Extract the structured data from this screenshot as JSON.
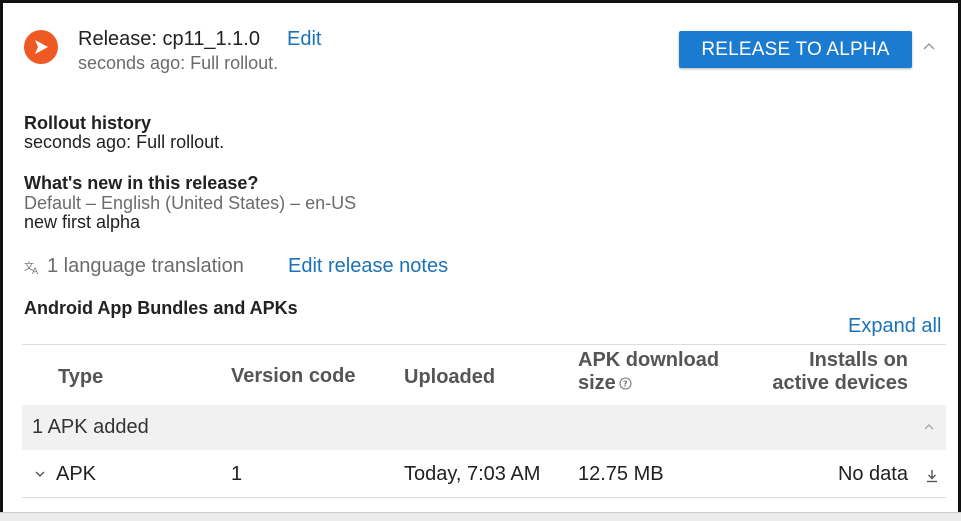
{
  "release": {
    "title": "Release: cp11_1.1.0",
    "edit_label": "Edit",
    "subtitle": "seconds ago: Full rollout.",
    "primary_button": "RELEASE TO ALPHA",
    "logo_color": "#ef5a24",
    "button_color": "#1a7bd0",
    "link_color": "#1a73b8"
  },
  "rollout": {
    "heading": "Rollout history",
    "text": "seconds ago: Full rollout."
  },
  "whats_new": {
    "heading": "What's new in this release?",
    "language": "Default – English (United States) – en-US",
    "notes": "new first alpha"
  },
  "translation": {
    "icon": "translate-icon",
    "text": "1 language translation",
    "edit_notes_label": "Edit release notes"
  },
  "bundles": {
    "heading": "Android App Bundles and APKs",
    "expand_all_label": "Expand all",
    "columns": {
      "type": "Type",
      "version_code": "Version code",
      "uploaded": "Uploaded",
      "apk_size_line1": "APK download",
      "apk_size_line2": "size",
      "installs_line1": "Installs on",
      "installs_line2": "active devices"
    },
    "group": {
      "label": "1 APK added"
    },
    "rows": [
      {
        "type": "APK",
        "version_code": "1",
        "uploaded": "Today, 7:03 AM",
        "size": "12.75 MB",
        "installs": "No data"
      }
    ]
  }
}
